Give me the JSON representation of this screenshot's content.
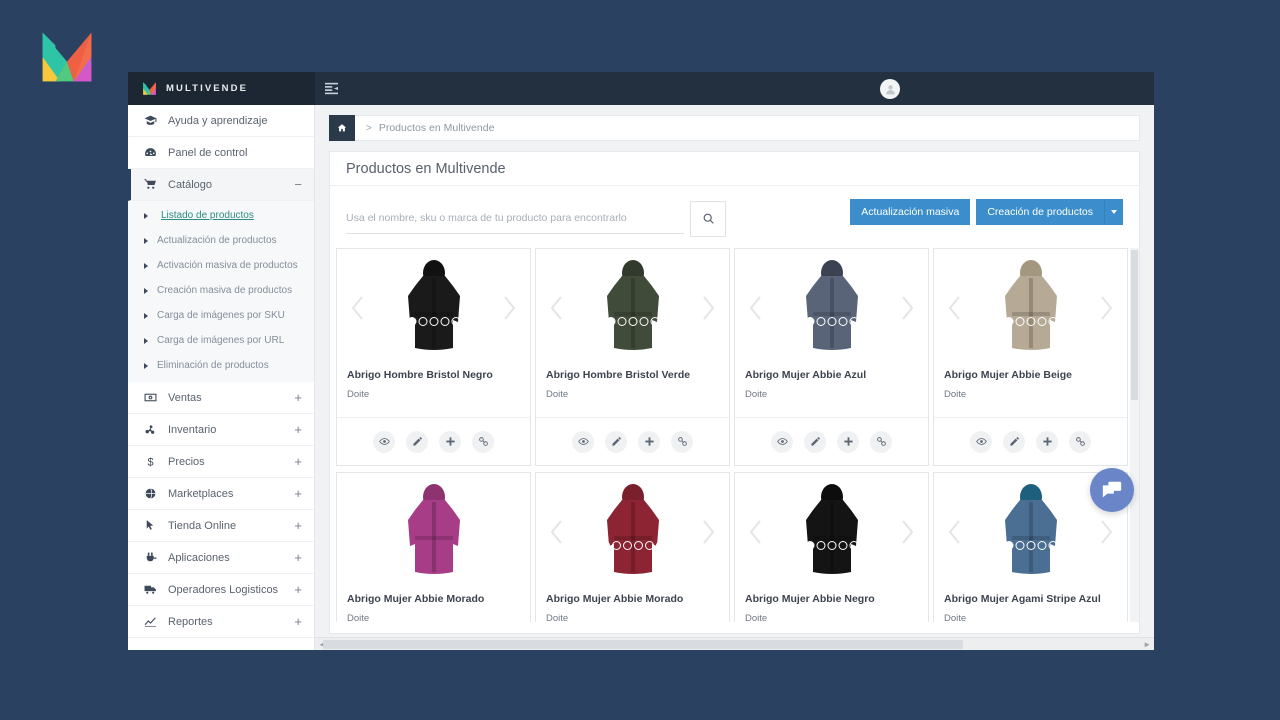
{
  "brand": {
    "name": "MULTIVENDE",
    "logo_icon": "multivende-m-logo"
  },
  "navbar": {
    "toggle_icon": "sidebar-toggle-icon",
    "avatar_icon": "user-avatar-placeholder"
  },
  "sidebar": {
    "items": [
      {
        "label": "Ayuda y aprendizaje",
        "icon": "graduation-cap-icon",
        "sign": ""
      },
      {
        "label": "Panel de control",
        "icon": "dashboard-icon",
        "sign": ""
      },
      {
        "label": "Catálogo",
        "icon": "cart-icon",
        "sign": "−",
        "active": true
      }
    ],
    "catalog_subitems": [
      {
        "label": "Listado de productos",
        "current": true
      },
      {
        "label": "Actualización de productos",
        "current": false
      },
      {
        "label": "Activación masiva de productos",
        "current": false
      },
      {
        "label": "Creación masiva de productos",
        "current": false
      },
      {
        "label": "Carga de imágenes por SKU",
        "current": false
      },
      {
        "label": "Carga de imágenes por URL",
        "current": false
      },
      {
        "label": "Eliminación de productos",
        "current": false
      }
    ],
    "items_after": [
      {
        "label": "Ventas",
        "icon": "money-icon",
        "sign": "+"
      },
      {
        "label": "Inventario",
        "icon": "boxes-icon",
        "sign": "+"
      },
      {
        "label": "Precios",
        "icon": "dollar-icon",
        "sign": "+"
      },
      {
        "label": "Marketplaces",
        "icon": "globe-icon",
        "sign": "+"
      },
      {
        "label": "Tienda Online",
        "icon": "cursor-icon",
        "sign": "+"
      },
      {
        "label": "Aplicaciones",
        "icon": "plug-icon",
        "sign": "+"
      },
      {
        "label": "Operadores Logisticos",
        "icon": "truck-icon",
        "sign": "+"
      },
      {
        "label": "Reportes",
        "icon": "chart-line-icon",
        "sign": "+"
      }
    ]
  },
  "breadcrumb": {
    "home_icon": "home-icon",
    "separator": ">",
    "current": "Productos en Multivende"
  },
  "panel": {
    "title": "Productos en Multivende"
  },
  "search": {
    "placeholder": "Usa el nombre, sku o marca de tu producto para encontrarlo",
    "value": "",
    "button_icon": "search-icon"
  },
  "toolbar": {
    "bulk_update_label": "Actualización masiva",
    "create_products_label": "Creación de productos",
    "dropdown_icon": "chevron-down-icon",
    "accent_color": "#3b8ecb"
  },
  "card_actions": [
    {
      "icon": "eye-icon",
      "name": "view"
    },
    {
      "icon": "pencil-icon",
      "name": "edit"
    },
    {
      "icon": "plus-icon",
      "name": "add"
    },
    {
      "icon": "link-icon",
      "name": "link"
    }
  ],
  "products": [
    {
      "title": "Abrigo Hombre Bristol Negro",
      "brand": "Doite",
      "dots": 5,
      "active_dot": 0,
      "color": "#1a1a1a",
      "hood": "#111111",
      "show_arrows": true
    },
    {
      "title": "Abrigo Hombre Bristol Verde",
      "brand": "Doite",
      "dots": 5,
      "active_dot": 0,
      "color": "#414b3a",
      "hood": "#323a2d",
      "show_arrows": true
    },
    {
      "title": "Abrigo Mujer Abbie Azul",
      "brand": "Doite",
      "dots": 5,
      "active_dot": 0,
      "color": "#5a6478",
      "hood": "#3b4252",
      "show_arrows": true
    },
    {
      "title": "Abrigo Mujer Abbie Beige",
      "brand": "Doite",
      "dots": 5,
      "active_dot": 0,
      "color": "#b6a995",
      "hood": "#a3977f",
      "show_arrows": true
    },
    {
      "title": "Abrigo Mujer Abbie Morado",
      "brand": "Doite",
      "dots": 0,
      "active_dot": -1,
      "color": "#a63d86",
      "hood": "#8e3370",
      "show_arrows": false
    },
    {
      "title": "Abrigo Mujer Abbie Morado",
      "brand": "Doite",
      "dots": 6,
      "active_dot": -1,
      "color": "#8c2433",
      "hood": "#7a1f2c",
      "show_arrows": true
    },
    {
      "title": "Abrigo Mujer Abbie Negro",
      "brand": "Doite",
      "dots": 5,
      "active_dot": 0,
      "color": "#141414",
      "hood": "#0d0d0d",
      "show_arrows": true
    },
    {
      "title": "Abrigo Mujer Agami Stripe Azul",
      "brand": "Doite",
      "dots": 5,
      "active_dot": 0,
      "color": "#4b6e93",
      "hood": "#1d5f7c",
      "show_arrows": true
    }
  ],
  "scrollbar": {
    "left_arrow": "◄",
    "right_arrow": "►"
  },
  "chat": {
    "icon": "chat-bubble-icon",
    "color": "#6a86c9"
  }
}
